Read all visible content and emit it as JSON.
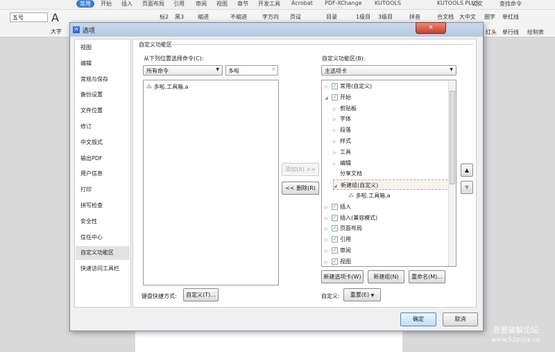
{
  "app": {
    "tabs": [
      "常用",
      "开始",
      "插入",
      "页面布局",
      "引用",
      "审阅",
      "视图",
      "章节",
      "开发工具",
      "Acrobat",
      "PDF-XChange",
      "KUTOOLS",
      "KUTOOLS PLUS",
      "公文",
      "查找命令"
    ],
    "active_tab": "常用",
    "ribbon": {
      "font_size": "五号",
      "big_font": "大字",
      "items": [
        "标2",
        "黑3",
        "缩进",
        "不缩进",
        "字方向",
        "页设",
        "目录",
        "1级目",
        "3级目",
        "拼音",
        "合文档",
        "大中文",
        "圈字",
        "单红线",
        "红头",
        "单行线",
        "绘制表"
      ]
    }
  },
  "dialog": {
    "title": "选项",
    "close": "×",
    "nav": [
      "视图",
      "编辑",
      "常规与保存",
      "备份设置",
      "文件位置",
      "修订",
      "中文版式",
      "输出PDF",
      "用户信息",
      "打印",
      "拼写检查",
      "安全性",
      "信任中心",
      "自定义功能区",
      "快速访问工具栏"
    ],
    "nav_selected": "自定义功能区",
    "section_title": "自定义功能区",
    "left": {
      "label": "从下列位置选择命令(C):",
      "source": "所有命令",
      "search_value": "多啦",
      "items": [
        "多啦.工具箱.a"
      ]
    },
    "add": "添加(A) >>",
    "remove": "<< 删除(R)",
    "right": {
      "label": "自定义功能区(B):",
      "tabs_select": "主选项卡",
      "tree": [
        {
          "label": "常用(自定义)",
          "level": 0,
          "checked": true,
          "expanded": false
        },
        {
          "label": "开始",
          "level": 0,
          "checked": true,
          "expanded": true
        },
        {
          "label": "剪贴板",
          "level": 1,
          "expanded": false
        },
        {
          "label": "字体",
          "level": 1,
          "expanded": false
        },
        {
          "label": "段落",
          "level": 1,
          "expanded": false
        },
        {
          "label": "样式",
          "level": 1,
          "expanded": false
        },
        {
          "label": "工具",
          "level": 1,
          "expanded": false
        },
        {
          "label": "编辑",
          "level": 1,
          "expanded": false
        },
        {
          "label": "分享文档",
          "level": 1
        },
        {
          "label": "新建组(自定义)",
          "level": 1,
          "expanded": true,
          "selected": true
        },
        {
          "label": "多啦.工具箱.a",
          "level": 2
        },
        {
          "label": "插入",
          "level": 0,
          "checked": true,
          "expanded": false
        },
        {
          "label": "插入(兼容模式)",
          "level": 0,
          "checked": true,
          "expanded": false
        },
        {
          "label": "页面布局",
          "level": 0,
          "checked": true,
          "expanded": false
        },
        {
          "label": "引用",
          "level": 0,
          "checked": true,
          "expanded": false
        },
        {
          "label": "审阅",
          "level": 0,
          "checked": true,
          "expanded": false
        },
        {
          "label": "视图",
          "level": 0,
          "checked": true,
          "expanded": false
        }
      ],
      "new_tab": "新建选项卡(W)",
      "new_group": "新建组(N)",
      "rename": "重命名(M)...",
      "custom_label": "自定义:",
      "reset": "重置(E)"
    },
    "keyboard_label": "键盘快捷方式:",
    "keyboard_button": "自定义(T)...",
    "ok": "确定",
    "cancel": "取消"
  },
  "watermark": {
    "line1": "吾爱破解论坛",
    "line2": "www.52pojie.cn"
  }
}
